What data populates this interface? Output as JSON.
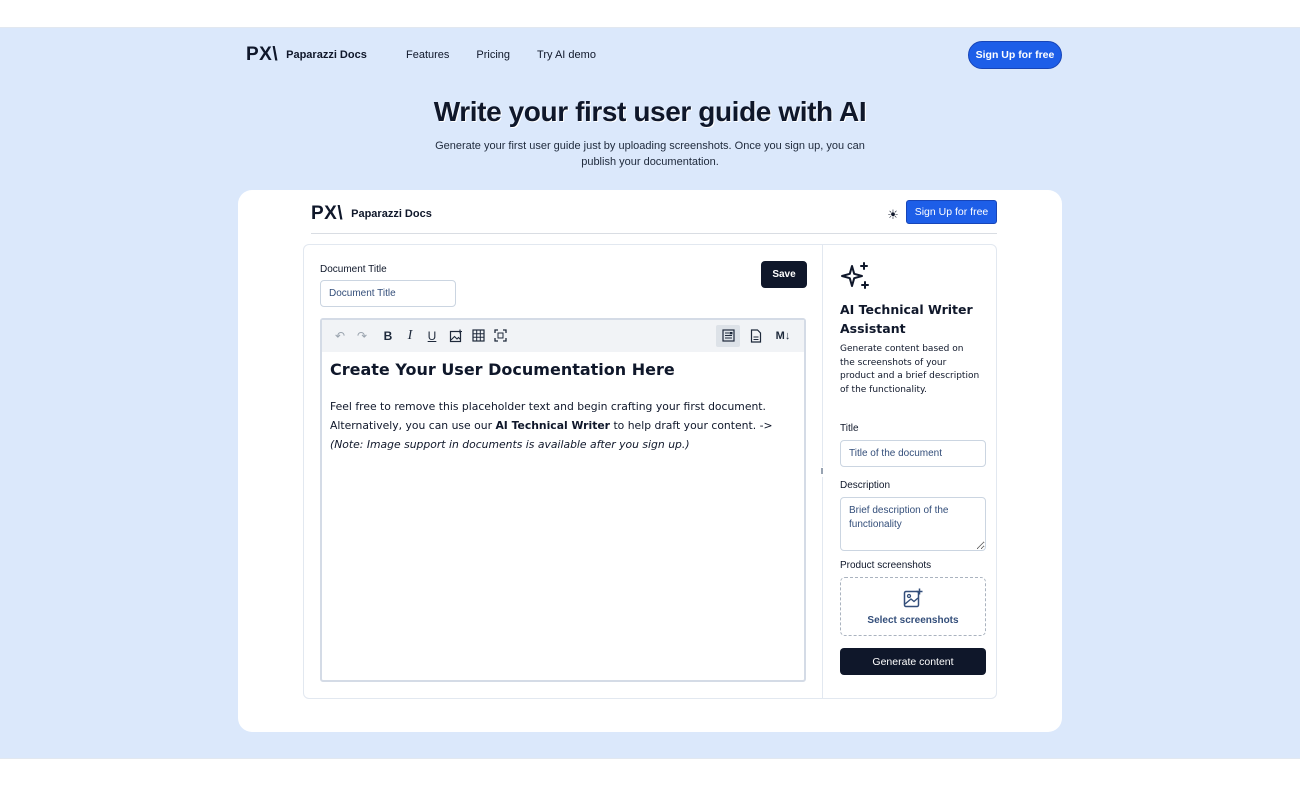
{
  "brand": {
    "mark": "PX\\",
    "name": "Paparazzi Docs"
  },
  "nav": {
    "links": [
      "Features",
      "Pricing",
      "Try AI demo"
    ],
    "signup": "Sign Up for free"
  },
  "hero": {
    "title": "Write your first user guide with AI",
    "subtitle": "Generate your first user guide just by uploading screenshots. Once you sign up, you can publish your documentation."
  },
  "app": {
    "signup": "Sign Up for free",
    "theme_icon": "sun-icon",
    "editor": {
      "doc_title_label": "Document Title",
      "doc_title_placeholder": "Document Title",
      "save_label": "Save",
      "toolbar_icons": [
        "undo-icon",
        "redo-icon",
        "bold-icon",
        "italic-icon",
        "underline-icon",
        "insert-image-icon",
        "table-icon",
        "fullscreen-icon",
        "rich-text-view-icon",
        "document-view-icon",
        "markdown-icon"
      ],
      "toolbar_glyphs": {
        "bold": "B",
        "italic": "I",
        "underline": "U",
        "markdown": "M↓"
      },
      "heading": "Create Your User Documentation Here",
      "para_1": "Feel free to remove this placeholder text and begin crafting your first document. Alternatively, you can use our ",
      "para_bold": "AI Technical Writer",
      "para_2": " to help draft your content. ->",
      "note": "(Note: Image support in documents is available after you sign up.)"
    },
    "assistant": {
      "icon": "sparkles-icon",
      "title": "AI Technical Writer Assistant",
      "description": "Generate content based on the screenshots of your product and a brief description of the functionality.",
      "title_label": "Title",
      "title_placeholder": "Title of the document",
      "description_label": "Description",
      "description_placeholder": "Brief description of the functionality",
      "screenshots_label": "Product screenshots",
      "select_label": "Select screenshots",
      "generate_label": "Generate content"
    }
  },
  "colors": {
    "background": "#dbe8fb",
    "primary": "#1d5ee8",
    "dark": "#0f172a"
  }
}
